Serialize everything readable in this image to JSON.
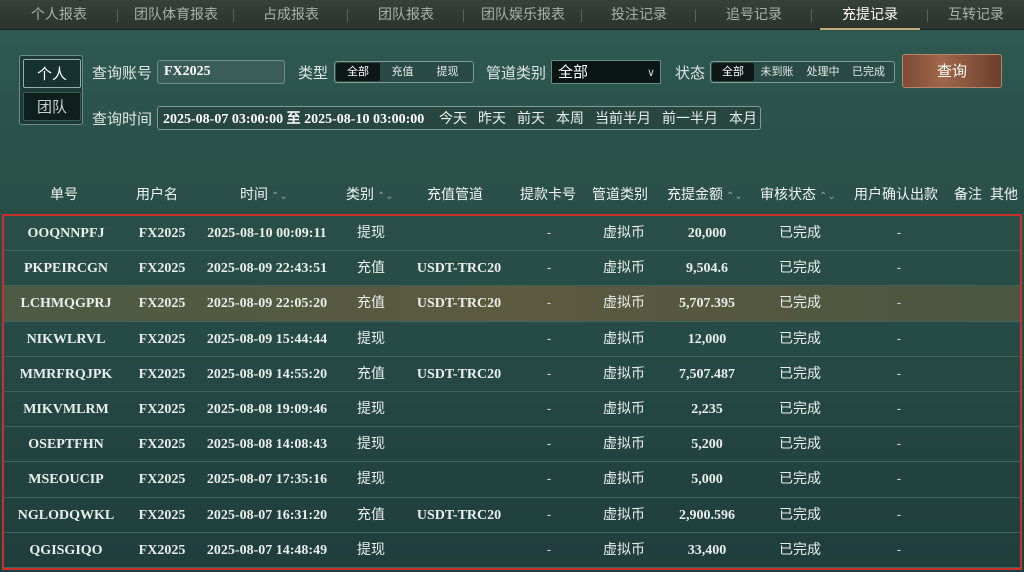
{
  "tabs": [
    {
      "label": "个人报表"
    },
    {
      "label": "团队体育报表"
    },
    {
      "label": "占成报表"
    },
    {
      "label": "团队报表"
    },
    {
      "label": "团队娱乐报表"
    },
    {
      "label": "投注记录"
    },
    {
      "label": "追号记录"
    },
    {
      "label": "充提记录",
      "active": true
    },
    {
      "label": "互转记录"
    }
  ],
  "filter": {
    "mode_personal": "个人",
    "mode_team": "团队",
    "account_label": "查询账号",
    "account_value": "FX2025",
    "type_label": "类型",
    "type_options": [
      "全部",
      "充值",
      "提现"
    ],
    "channel_label": "管道类别",
    "channel_value": "全部",
    "status_label": "状态",
    "status_options": [
      "全部",
      "未到账",
      "处理中",
      "已完成"
    ],
    "query_button": "查询",
    "time_label": "查询时间",
    "date_range": "2025-08-07 03:00:00 至 2025-08-10 03:00:00",
    "quick_ranges": [
      "今天",
      "昨天",
      "前天",
      "本周",
      "当前半月",
      "前一半月",
      "本月"
    ]
  },
  "table": {
    "headers": {
      "order_no": "单号",
      "username": "用户名",
      "time": "时间",
      "category": "类别",
      "recharge_channel": "充值管道",
      "withdraw_card": "提款卡号",
      "channel_type": "管道类别",
      "amount": "充提金额",
      "review_status": "审核状态",
      "user_confirm": "用户确认出款",
      "remark": "备注",
      "other": "其他"
    },
    "rows": [
      {
        "order_no": "OOQNNPFJ",
        "username": "FX2025",
        "time": "2025-08-10 00:09:11",
        "category": "提现",
        "channel": "",
        "card": "-",
        "channel_type": "虚拟币",
        "amount": "20,000",
        "status": "已完成",
        "confirm": "-"
      },
      {
        "order_no": "PKPEIRCGN",
        "username": "FX2025",
        "time": "2025-08-09 22:43:51",
        "category": "充值",
        "channel": "USDT-TRC20",
        "card": "-",
        "channel_type": "虚拟币",
        "amount": "9,504.6",
        "status": "已完成",
        "confirm": "-"
      },
      {
        "order_no": "LCHMQGPRJ",
        "username": "FX2025",
        "time": "2025-08-09 22:05:20",
        "category": "充值",
        "channel": "USDT-TRC20",
        "card": "-",
        "channel_type": "虚拟币",
        "amount": "5,707.395",
        "status": "已完成",
        "confirm": "-"
      },
      {
        "order_no": "NIKWLRVL",
        "username": "FX2025",
        "time": "2025-08-09 15:44:44",
        "category": "提现",
        "channel": "",
        "card": "-",
        "channel_type": "虚拟币",
        "amount": "12,000",
        "status": "已完成",
        "confirm": "-"
      },
      {
        "order_no": "MMRFRQJPK",
        "username": "FX2025",
        "time": "2025-08-09 14:55:20",
        "category": "充值",
        "channel": "USDT-TRC20",
        "card": "-",
        "channel_type": "虚拟币",
        "amount": "7,507.487",
        "status": "已完成",
        "confirm": "-"
      },
      {
        "order_no": "MIKVMLRM",
        "username": "FX2025",
        "time": "2025-08-08 19:09:46",
        "category": "提现",
        "channel": "",
        "card": "-",
        "channel_type": "虚拟币",
        "amount": "2,235",
        "status": "已完成",
        "confirm": "-"
      },
      {
        "order_no": "OSEPTFHN",
        "username": "FX2025",
        "time": "2025-08-08 14:08:43",
        "category": "提现",
        "channel": "",
        "card": "-",
        "channel_type": "虚拟币",
        "amount": "5,200",
        "status": "已完成",
        "confirm": "-"
      },
      {
        "order_no": "MSEOUCIP",
        "username": "FX2025",
        "time": "2025-08-07 17:35:16",
        "category": "提现",
        "channel": "",
        "card": "-",
        "channel_type": "虚拟币",
        "amount": "5,000",
        "status": "已完成",
        "confirm": "-"
      },
      {
        "order_no": "NGLODQWKL",
        "username": "FX2025",
        "time": "2025-08-07 16:31:20",
        "category": "充值",
        "channel": "USDT-TRC20",
        "card": "-",
        "channel_type": "虚拟币",
        "amount": "2,900.596",
        "status": "已完成",
        "confirm": "-"
      },
      {
        "order_no": "QGISGIQO",
        "username": "FX2025",
        "time": "2025-08-07 14:48:49",
        "category": "提现",
        "channel": "",
        "card": "-",
        "channel_type": "虚拟币",
        "amount": "33,400",
        "status": "已完成",
        "confirm": "-"
      }
    ]
  },
  "colors": {
    "accent_tab_underline": "#c7a77a",
    "query_button": "#a0674a",
    "table_border": "#c6322b"
  }
}
